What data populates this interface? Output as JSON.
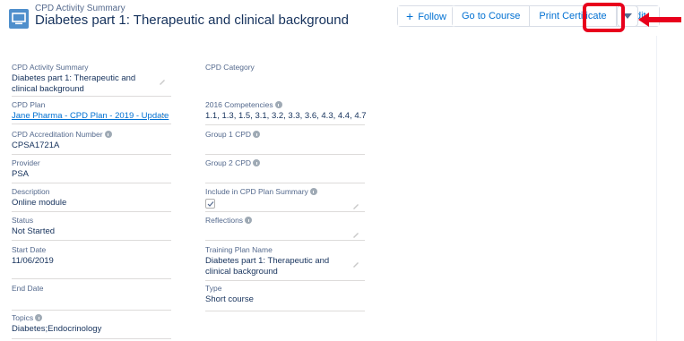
{
  "header": {
    "object_label": "CPD Activity Summary",
    "record_title": "Diabetes part 1: Therapeutic and clinical background",
    "follow_label": "Follow",
    "buttons": [
      "Go to Course",
      "Print Certificate",
      "Edit"
    ]
  },
  "left_fields": [
    {
      "label": "CPD Activity Summary",
      "value": "Diabetes part 1: Therapeutic and clinical background"
    },
    {
      "label": "CPD Plan",
      "value": "Jane Pharma - CPD Plan - 2019 - Update"
    },
    {
      "label": "CPD Accreditation Number",
      "value": "CPSA1721A"
    },
    {
      "label": "Provider",
      "value": "PSA"
    },
    {
      "label": "Description",
      "value": "Online module"
    },
    {
      "label": "Status",
      "value": "Not Started"
    },
    {
      "label": "Start Date",
      "value": "11/06/2019"
    },
    {
      "label": "End Date",
      "value": ""
    },
    {
      "label": "Topics",
      "value": "Diabetes;Endocrinology"
    }
  ],
  "right_fields": [
    {
      "label": "CPD Category",
      "value": ""
    },
    {
      "label": "2016 Competencies",
      "value": "1.1, 1.3, 1.5, 3.1, 3.2, 3.3, 3.6, 4.3, 4.4, 4.7"
    },
    {
      "label": "Group 1 CPD",
      "value": ""
    },
    {
      "label": "Group 2 CPD",
      "value": ""
    },
    {
      "label": "Include in CPD Plan Summary",
      "value": true
    },
    {
      "label": "Reflections",
      "value": ""
    },
    {
      "label": "Training Plan Name",
      "value": "Diabetes part 1: Therapeutic and clinical background"
    },
    {
      "label": "Type",
      "value": "Short course"
    }
  ],
  "icons": {
    "record_icon": "monitor-icon",
    "follow_icon": "plus-icon",
    "dropdown_icon": "caret-down-icon",
    "help_icon": "info-icon",
    "edit_icon": "pencil-icon",
    "annotation_arrow": "left-arrow-icon"
  },
  "colors": {
    "brand_blue": "#0070d2",
    "record_icon_bg": "#4f8fcc",
    "highlight_red": "#e8001c",
    "text_dark": "#16325c",
    "label_gray": "#54698d"
  }
}
